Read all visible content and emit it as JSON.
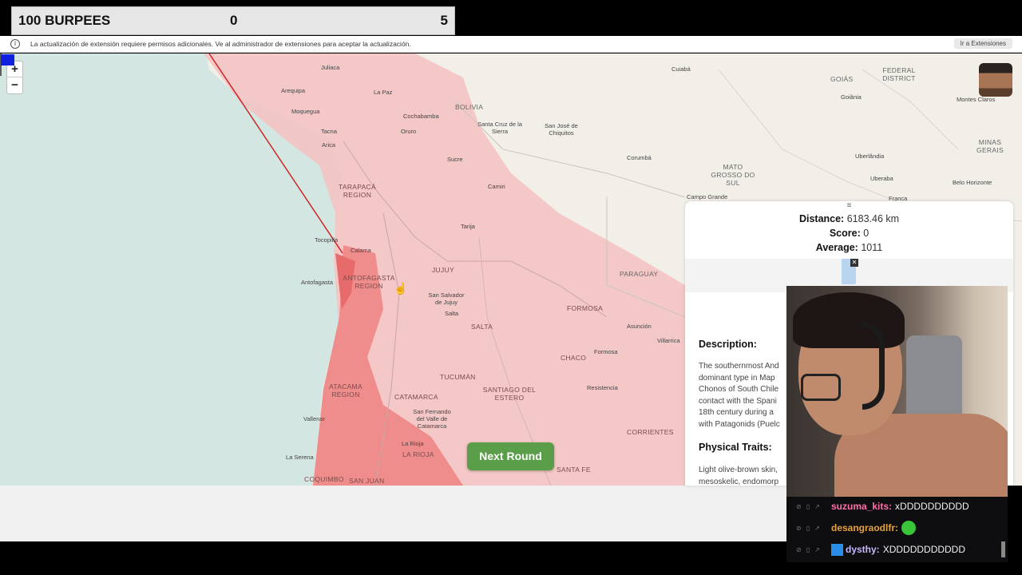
{
  "counter": {
    "name": "100 BURPEES",
    "current": "0",
    "goal": "5"
  },
  "extension_bar": {
    "icon": "info-icon",
    "message": "La actualización de extensión requiere permisos adicionales. Ve al administrador de extensiones para aceptar la actualización.",
    "button": "Ir a Extensiones"
  },
  "map": {
    "zoom_in": "+",
    "zoom_out": "−",
    "places": {
      "juliaca": "Juliaca",
      "lapaz": "La Paz",
      "arequipa": "Arequipa",
      "moquegua": "Moquegua",
      "tacna": "Tacna",
      "arica": "Arica",
      "cochabamba": "Cochabamba",
      "oruro": "Oruro",
      "sucre": "Sucre",
      "santacruz": "Santa Cruz de la Sierra",
      "sanjose": "San José de Chiquitos",
      "camiri": "Camiri",
      "tarija": "Tarija",
      "cuiaba": "Cuiabá",
      "corumba": "Corumbá",
      "goiania": "Goiânia",
      "uberlandia": "Uberlândia",
      "uberaba": "Uberaba",
      "franca": "Franca",
      "campogrande": "Campo Grande",
      "montesclaros": "Montes Claros",
      "belohorizonte": "Belo Horizonte",
      "tocopilla": "Tocopilla",
      "calama": "Calama",
      "antofagasta": "Antofagasta",
      "sansalvador": "San Salvador de Jujuy",
      "salta": "Salta",
      "asuncion": "Asunción",
      "villarrica": "Villarrica",
      "formosa": "Formosa",
      "resistencia": "Resistencia",
      "sanfernando": "San Fernando del Valle de Catamarca",
      "larioja": "La Rioja",
      "vallenar": "Vallenar",
      "laserena": "La Serena"
    },
    "regions": {
      "bolivia": "BOLIVIA",
      "goias": "GOIÁS",
      "federal": "FEDERAL DISTRICT",
      "mato": "MATO GROSSO DO SUL",
      "minas": "MINAS GERAIS",
      "tarapaca": "TARAPACÁ REGION",
      "antofagasta_r": "ANTOFAGASTA REGION",
      "jujuy": "JUJUY",
      "paraguay": "PARAGUAY",
      "formosa_r": "FORMOSA",
      "salta_r": "SALTA",
      "chaco": "CHACO",
      "tucuman": "TUCUMÁN",
      "atacama": "ATACAMA REGION",
      "catamarca": "CATAMARCA",
      "santiago": "SANTIAGO DEL ESTERO",
      "corrientes": "CORRIENTES",
      "larioja_r": "LA RIOJA",
      "santafe": "SANTA FE",
      "coquimbo": "COQUIMBO",
      "sanjuan": "SAN JUAN"
    },
    "next_round": "Next Round"
  },
  "result_panel": {
    "handle": "≡",
    "distance_label": "Distance:",
    "distance_value": "6183.46 km",
    "score_label": "Score:",
    "score_value": "0",
    "average_label": "Average:",
    "average_value": "1011",
    "description_heading": "Description:",
    "description_lines": [
      "The southernmost And",
      "dominant type in Map",
      "Chonos of South Chile",
      "contact with the Spani",
      "18th century during a",
      "with Patagonids (Puelc"
    ],
    "traits_heading": "Physical Traits:",
    "traits_lines": [
      "Light olive-brown skin,",
      "mesoskelic, endomorp"
    ]
  },
  "chat": {
    "messages": [
      {
        "user": "suzuma_kits:",
        "text": "xDDDDDDDDDD",
        "color": "#ff6fa8"
      },
      {
        "user": "desangraodlfr:",
        "text": "",
        "color": "#e6a23c"
      },
      {
        "user": "dysthy:",
        "text": "XDDDDDDDDDDD",
        "color": "#c8b6ff"
      }
    ]
  }
}
